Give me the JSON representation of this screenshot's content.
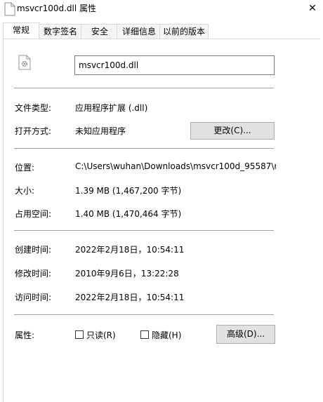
{
  "window": {
    "title": "msvcr100d.dll 属性",
    "close_glyph": "✕"
  },
  "tabs": [
    {
      "label": "常规",
      "active": true
    },
    {
      "label": "数字签名",
      "active": false
    },
    {
      "label": "安全",
      "active": false
    },
    {
      "label": "详细信息",
      "active": false
    },
    {
      "label": "以前的版本",
      "active": false
    }
  ],
  "file": {
    "name": "msvcr100d.dll",
    "icon": "dll-file-gear-icon"
  },
  "info": {
    "type_label": "文件类型:",
    "type_value": "应用程序扩展 (.dll)",
    "open_label": "打开方式:",
    "open_value": "未知应用程序",
    "change_button": "更改(C)...",
    "location_label": "位置:",
    "location_value": "C:\\Users\\wuhan\\Downloads\\msvcr100d_95587\\m",
    "size_label": "大小:",
    "size_value": "1.39 MB (1,467,200 字节)",
    "disk_label": "占用空间:",
    "disk_value": "1.40 MB (1,470,464 字节)",
    "created_label": "创建时间:",
    "created_value": "2022年2月18日，10:54:11",
    "modified_label": "修改时间:",
    "modified_value": "2010年9月6日，13:22:28",
    "accessed_label": "访问时间:",
    "accessed_value": "2022年2月18日，10:54:11",
    "attr_label": "属性:",
    "readonly_label": "只读(R)",
    "readonly_checked": false,
    "hidden_label": "隐藏(H)",
    "hidden_checked": false,
    "advanced_button": "高级(D)..."
  }
}
